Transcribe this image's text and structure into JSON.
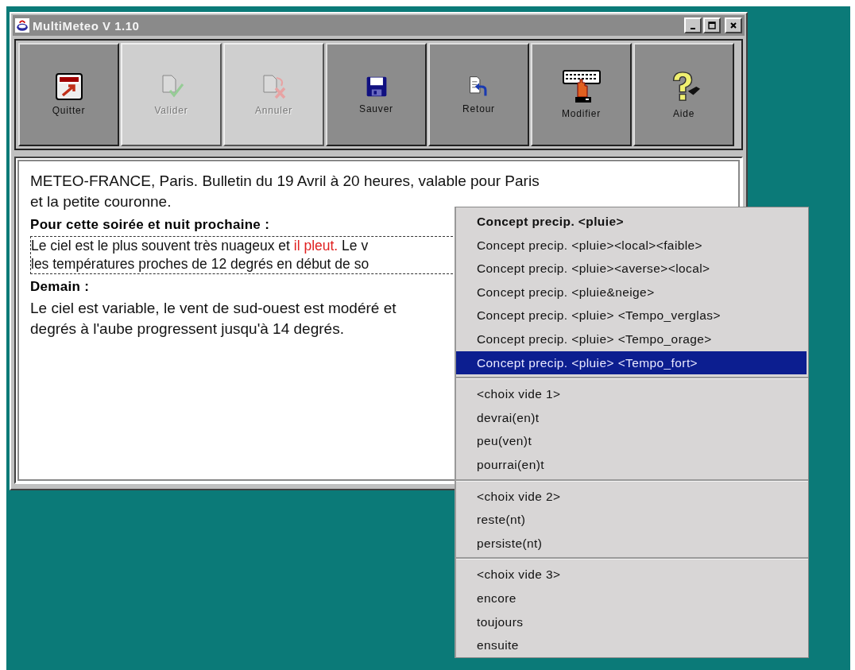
{
  "window": {
    "title": "MultiMeteo V 1.10"
  },
  "toolbar": [
    {
      "label": "Quitter",
      "kind": "exit",
      "disabled": false
    },
    {
      "label": "Valider",
      "kind": "validate",
      "disabled": true
    },
    {
      "label": "Annuler",
      "kind": "cancel",
      "disabled": true
    },
    {
      "label": "Sauver",
      "kind": "save",
      "disabled": false
    },
    {
      "label": "Retour",
      "kind": "back",
      "disabled": false
    },
    {
      "label": "Modifier",
      "kind": "edit",
      "disabled": false
    },
    {
      "label": "Aide",
      "kind": "help",
      "disabled": false
    }
  ],
  "document": [
    {
      "kind": "text",
      "lines": [
        [
          {
            "text": "METEO-FRANCE, Paris. Bulletin du 19 Avril à 20 heures,  valable pour Paris",
            "kind": "plain"
          }
        ],
        [
          {
            "text": "et la petite couronne.",
            "kind": "plain"
          }
        ]
      ]
    },
    {
      "kind": "heading",
      "text": "Pour cette soirée et nuit prochaine :"
    },
    {
      "kind": "focused",
      "lines": [
        [
          {
            "text": "Le ciel est le plus souvent très nuageux et ",
            "kind": "plain"
          },
          {
            "text": "il pleut.",
            "kind": "concept"
          },
          {
            "text": " Le v",
            "kind": "plain"
          }
        ],
        [
          {
            "text": "les températures proches de 12 degrés en début de so",
            "kind": "plain"
          }
        ]
      ]
    },
    {
      "kind": "heading",
      "text": "Demain :"
    },
    {
      "kind": "text",
      "lines": [
        [
          {
            "text": "Le ciel est variable, le vent de sud-ouest est modéré et",
            "kind": "plain"
          }
        ],
        [
          {
            "text": "degrés à l'aube progressent jusqu'à 14 degrés.",
            "kind": "plain"
          }
        ]
      ]
    }
  ],
  "popup_menu": [
    {
      "items": [
        {
          "label": "Concept precip. <pluie>",
          "current": true,
          "selected": false
        },
        {
          "label": "Concept precip. <pluie><local><faible>",
          "current": false,
          "selected": false
        },
        {
          "label": "Concept precip. <pluie><averse><local>",
          "current": false,
          "selected": false
        },
        {
          "label": "Concept precip. <pluie&neige>",
          "current": false,
          "selected": false
        },
        {
          "label": "Concept precip. <pluie> <Tempo_verglas>",
          "current": false,
          "selected": false
        },
        {
          "label": "Concept precip. <pluie> <Tempo_orage>",
          "current": false,
          "selected": false
        },
        {
          "label": "Concept precip. <pluie> <Tempo_fort>",
          "current": false,
          "selected": true
        }
      ]
    },
    {
      "items": [
        {
          "label": "<choix vide 1>",
          "current": false,
          "selected": false
        },
        {
          "label": "devrai(en)t",
          "current": false,
          "selected": false
        },
        {
          "label": "peu(ven)t",
          "current": false,
          "selected": false
        },
        {
          "label": "pourrai(en)t",
          "current": false,
          "selected": false
        }
      ]
    },
    {
      "items": [
        {
          "label": "<choix vide 2>",
          "current": false,
          "selected": false
        },
        {
          "label": "reste(nt)",
          "current": false,
          "selected": false
        },
        {
          "label": "persiste(nt)",
          "current": false,
          "selected": false
        }
      ]
    },
    {
      "items": [
        {
          "label": "<choix vide 3>",
          "current": false,
          "selected": false
        },
        {
          "label": "encore",
          "current": false,
          "selected": false
        },
        {
          "label": "toujours",
          "current": false,
          "selected": false
        },
        {
          "label": "ensuite",
          "current": false,
          "selected": false
        }
      ]
    }
  ]
}
